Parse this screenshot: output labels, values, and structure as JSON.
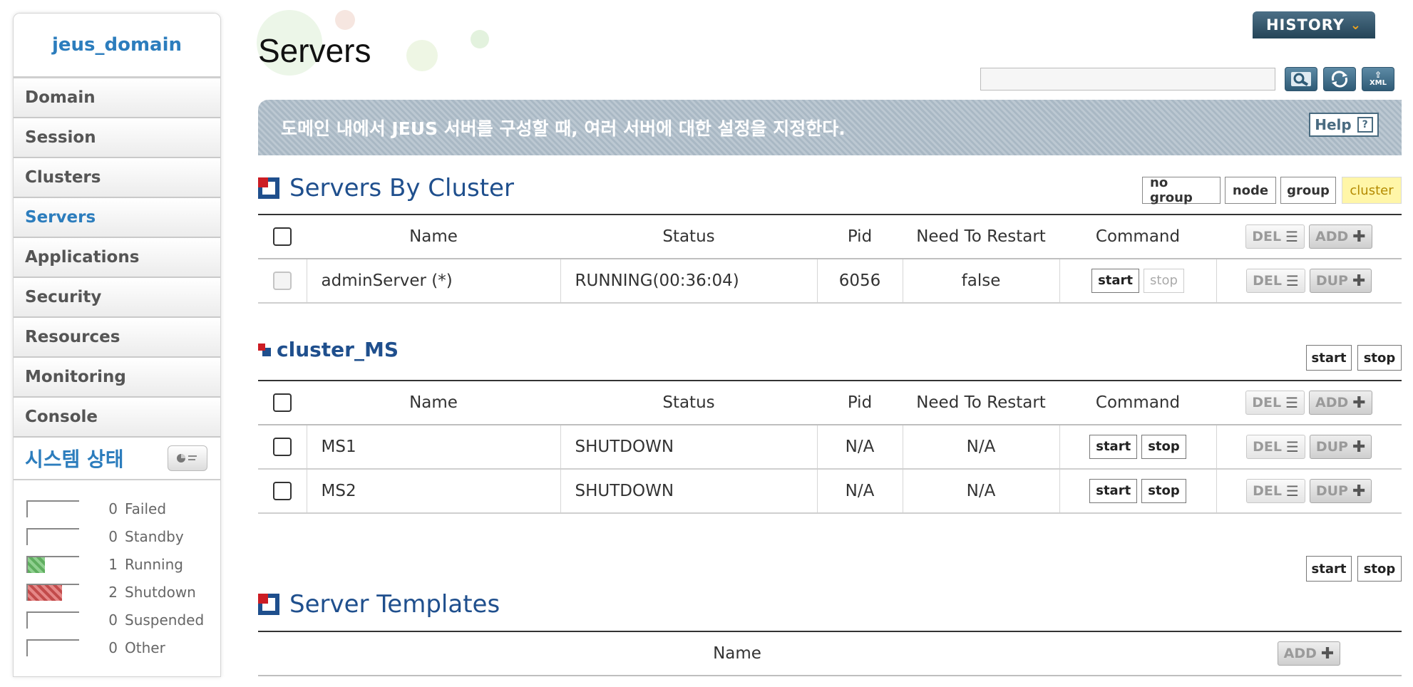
{
  "sidebar": {
    "domain": "jeus_domain",
    "items": [
      {
        "label": "Domain",
        "active": false
      },
      {
        "label": "Session",
        "active": false
      },
      {
        "label": "Clusters",
        "active": false
      },
      {
        "label": "Servers",
        "active": true
      },
      {
        "label": "Applications",
        "active": false
      },
      {
        "label": "Security",
        "active": false
      },
      {
        "label": "Resources",
        "active": false
      },
      {
        "label": "Monitoring",
        "active": false
      },
      {
        "label": "Console",
        "active": false
      }
    ],
    "system_status": {
      "title": "시스템 상태",
      "rows": [
        {
          "count": "0",
          "label": "Failed",
          "fill": 0,
          "color": "none"
        },
        {
          "count": "0",
          "label": "Standby",
          "fill": 0,
          "color": "none"
        },
        {
          "count": "1",
          "label": "Running",
          "fill": 0.33,
          "color": "green"
        },
        {
          "count": "2",
          "label": "Shutdown",
          "fill": 0.67,
          "color": "red"
        },
        {
          "count": "0",
          "label": "Suspended",
          "fill": 0,
          "color": "none"
        },
        {
          "count": "0",
          "label": "Other",
          "fill": 0,
          "color": "none"
        }
      ]
    }
  },
  "header": {
    "title": "Servers",
    "history": "HISTORY",
    "search_value": "",
    "xml_label": "XML"
  },
  "description": {
    "text": "도메인 내에서 JEUS 서버를 구성할 때, 여러 서버에 대한 설정을 지정한다.",
    "help": "Help",
    "help_q": "?"
  },
  "servers_by_cluster": {
    "title": "Servers By Cluster",
    "group_buttons": [
      "no group",
      "node",
      "group",
      "cluster"
    ],
    "columns": {
      "name": "Name",
      "status": "Status",
      "pid": "Pid",
      "restart": "Need To Restart",
      "command": "Command"
    },
    "del": "DEL",
    "add": "ADD",
    "dup": "DUP",
    "start": "start",
    "stop": "stop",
    "rows": [
      {
        "name": "adminServer (*)",
        "status": "RUNNING(00:36:04)",
        "pid": "6056",
        "restart": "false"
      }
    ]
  },
  "cluster": {
    "title": "cluster_MS",
    "rows": [
      {
        "name": "MS1",
        "status": "SHUTDOWN",
        "pid": "N/A",
        "restart": "N/A"
      },
      {
        "name": "MS2",
        "status": "SHUTDOWN",
        "pid": "N/A",
        "restart": "N/A"
      }
    ]
  },
  "templates": {
    "title": "Server Templates",
    "name_col": "Name",
    "add": "ADD"
  },
  "colors": {
    "accent": "#2c7dbd",
    "section": "#1f4f8d",
    "highlight": "#fff6a8",
    "running": "#5fae5f",
    "shutdown": "#c24b4b"
  }
}
